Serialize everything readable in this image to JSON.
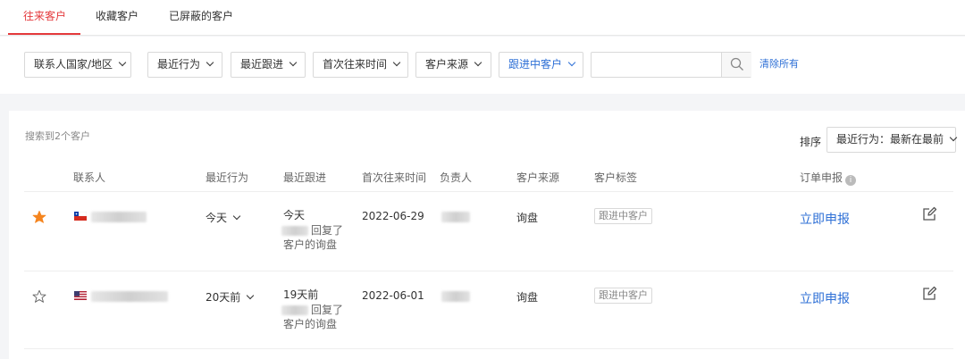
{
  "tabs": [
    {
      "label": "往来客户",
      "active": true
    },
    {
      "label": "收藏客户",
      "active": false
    },
    {
      "label": "已屏蔽的客户",
      "active": false
    }
  ],
  "filters": {
    "country": "联系人国家/地区",
    "recent_action": "最近行为",
    "last_follow": "最近跟进",
    "first_contact": "首次往来时间",
    "source": "客户来源",
    "follow_status": "跟进中客户",
    "search_value": "",
    "search_placeholder": "",
    "clear_all": "清除所有"
  },
  "results": {
    "count_text": "搜索到2个客户",
    "sort_label": "排序",
    "sort_value": "最近行为：最新在最前"
  },
  "table": {
    "columns": {
      "contact": "联系人",
      "recent_action": "最近行为",
      "last_follow": "最近跟进",
      "first_contact": "首次往来时间",
      "owner": "负责人",
      "source": "客户来源",
      "tags": "客户标签",
      "order": "订单申报"
    },
    "rows": [
      {
        "starred": true,
        "flag": "chile-flag-icon",
        "recent_action": "今天",
        "last_follow_time": "今天",
        "last_follow_line1": "回复了",
        "last_follow_line2": "客户的询盘",
        "first_contact": "2022-06-29",
        "source": "询盘",
        "tag": "跟进中客户",
        "order_action": "立即申报"
      },
      {
        "starred": false,
        "flag": "usa-flag-icon",
        "recent_action": "20天前",
        "last_follow_time": "19天前",
        "last_follow_line1": "回复了",
        "last_follow_line2": "客户的询盘",
        "first_contact": "2022-06-01",
        "source": "询盘",
        "tag": "跟进中客户",
        "order_action": "立即申报"
      }
    ]
  },
  "colors": {
    "accent_red": "#e4393c",
    "link_blue": "#2d6fd6",
    "star_orange": "#f5851f"
  }
}
